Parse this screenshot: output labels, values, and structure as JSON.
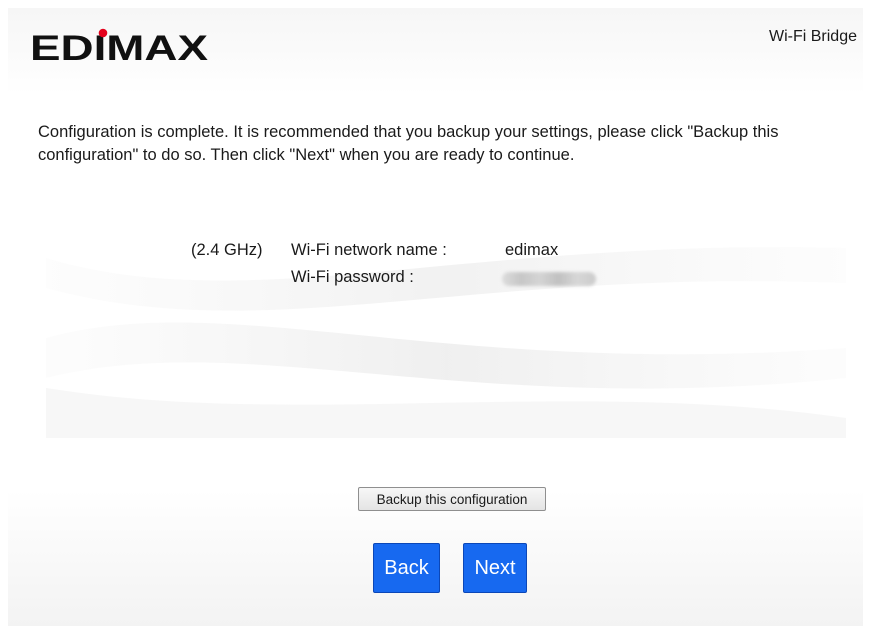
{
  "header": {
    "logo_text": "EDIMAX",
    "product_name": "Wi-Fi Bridge"
  },
  "message": "Configuration is complete. It is recommended that you backup your settings, please click \"Backup this configuration\" to do so. Then click \"Next\" when you are ready to continue.",
  "wifi": {
    "band_label": "(2.4 GHz)",
    "network_name_label": "Wi-Fi network name :",
    "network_name_value": "edimax",
    "password_label": "Wi-Fi password :"
  },
  "buttons": {
    "backup_label": "Backup this configuration",
    "back_label": "Back",
    "next_label": "Next"
  },
  "colors": {
    "primary_button": "#1769f0",
    "logo_dot": "#e3001b",
    "logo_text": "#111111"
  }
}
